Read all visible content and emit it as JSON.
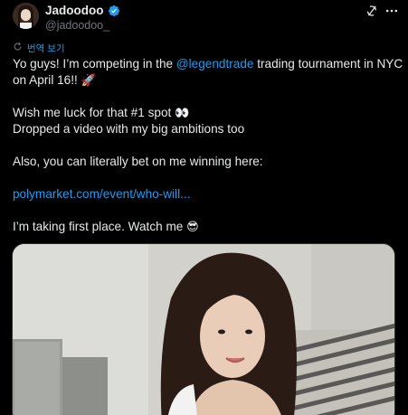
{
  "user": {
    "display_name": "Jadoodoo",
    "handle": "@jadoodoo_"
  },
  "translate_label": "번역 보기",
  "tweet": {
    "line1_part1": "Yo guys! I’m competing in the ",
    "line1_mention": "@legendtrade",
    "line1_part2": "  trading tournament in NYC",
    "line2_text": "on April 16!! ",
    "line2_emoji": "🚀",
    "line3_text": "Wish me luck for that #1 spot ",
    "line3_emoji": "👀",
    "line4": "Dropped a video with my big ambitions too",
    "line5": "Also, you can literally bet on me winning here:",
    "link": "polymarket.com/event/who-will...",
    "line6_text": "I’m taking first place. Watch me ",
    "line6_emoji": "😎"
  },
  "icons": {
    "verified": "verified-badge-icon",
    "grok": "grok-icon",
    "more": "more-icon",
    "translate": "translate-icon"
  },
  "colors": {
    "background": "#000000",
    "text": "#e7e9ea",
    "muted": "#71767b",
    "accent": "#1d9bf0"
  }
}
